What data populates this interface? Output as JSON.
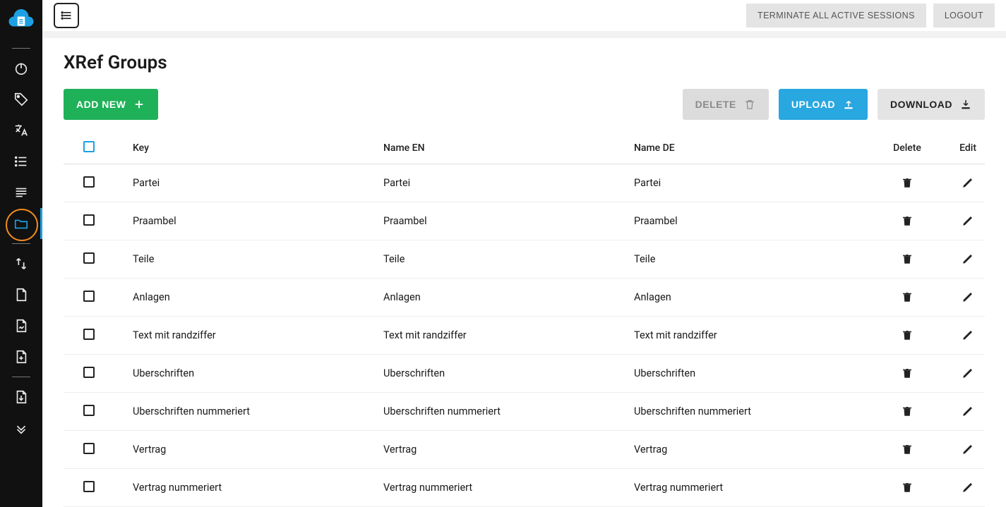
{
  "topbar": {
    "terminate_label": "TERMINATE ALL ACTIVE SESSIONS",
    "logout_label": "LOGOUT"
  },
  "page": {
    "title": "XRef Groups"
  },
  "toolbar": {
    "add_new": "ADD NEW",
    "delete": "DELETE",
    "upload": "UPLOAD",
    "download": "DOWNLOAD"
  },
  "table": {
    "headers": {
      "key": "Key",
      "name_en": "Name EN",
      "name_de": "Name DE",
      "delete": "Delete",
      "edit": "Edit"
    },
    "rows": [
      {
        "key": "Partei",
        "en": "Partei",
        "de": "Partei"
      },
      {
        "key": "Praambel",
        "en": "Praambel",
        "de": "Praambel"
      },
      {
        "key": "Teile",
        "en": "Teile",
        "de": "Teile"
      },
      {
        "key": "Anlagen",
        "en": "Anlagen",
        "de": "Anlagen"
      },
      {
        "key": "Text mit randziffer",
        "en": "Text mit randziffer",
        "de": "Text mit randziffer"
      },
      {
        "key": "Uberschriften",
        "en": "Uberschriften",
        "de": "Uberschriften"
      },
      {
        "key": "Uberschriften nummeriert",
        "en": "Uberschriften nummeriert",
        "de": "Uberschriften nummeriert"
      },
      {
        "key": "Vertrag",
        "en": "Vertrag",
        "de": "Vertrag"
      },
      {
        "key": "Vertrag nummeriert",
        "en": "Vertrag nummeriert",
        "de": "Vertrag nummeriert"
      }
    ]
  }
}
